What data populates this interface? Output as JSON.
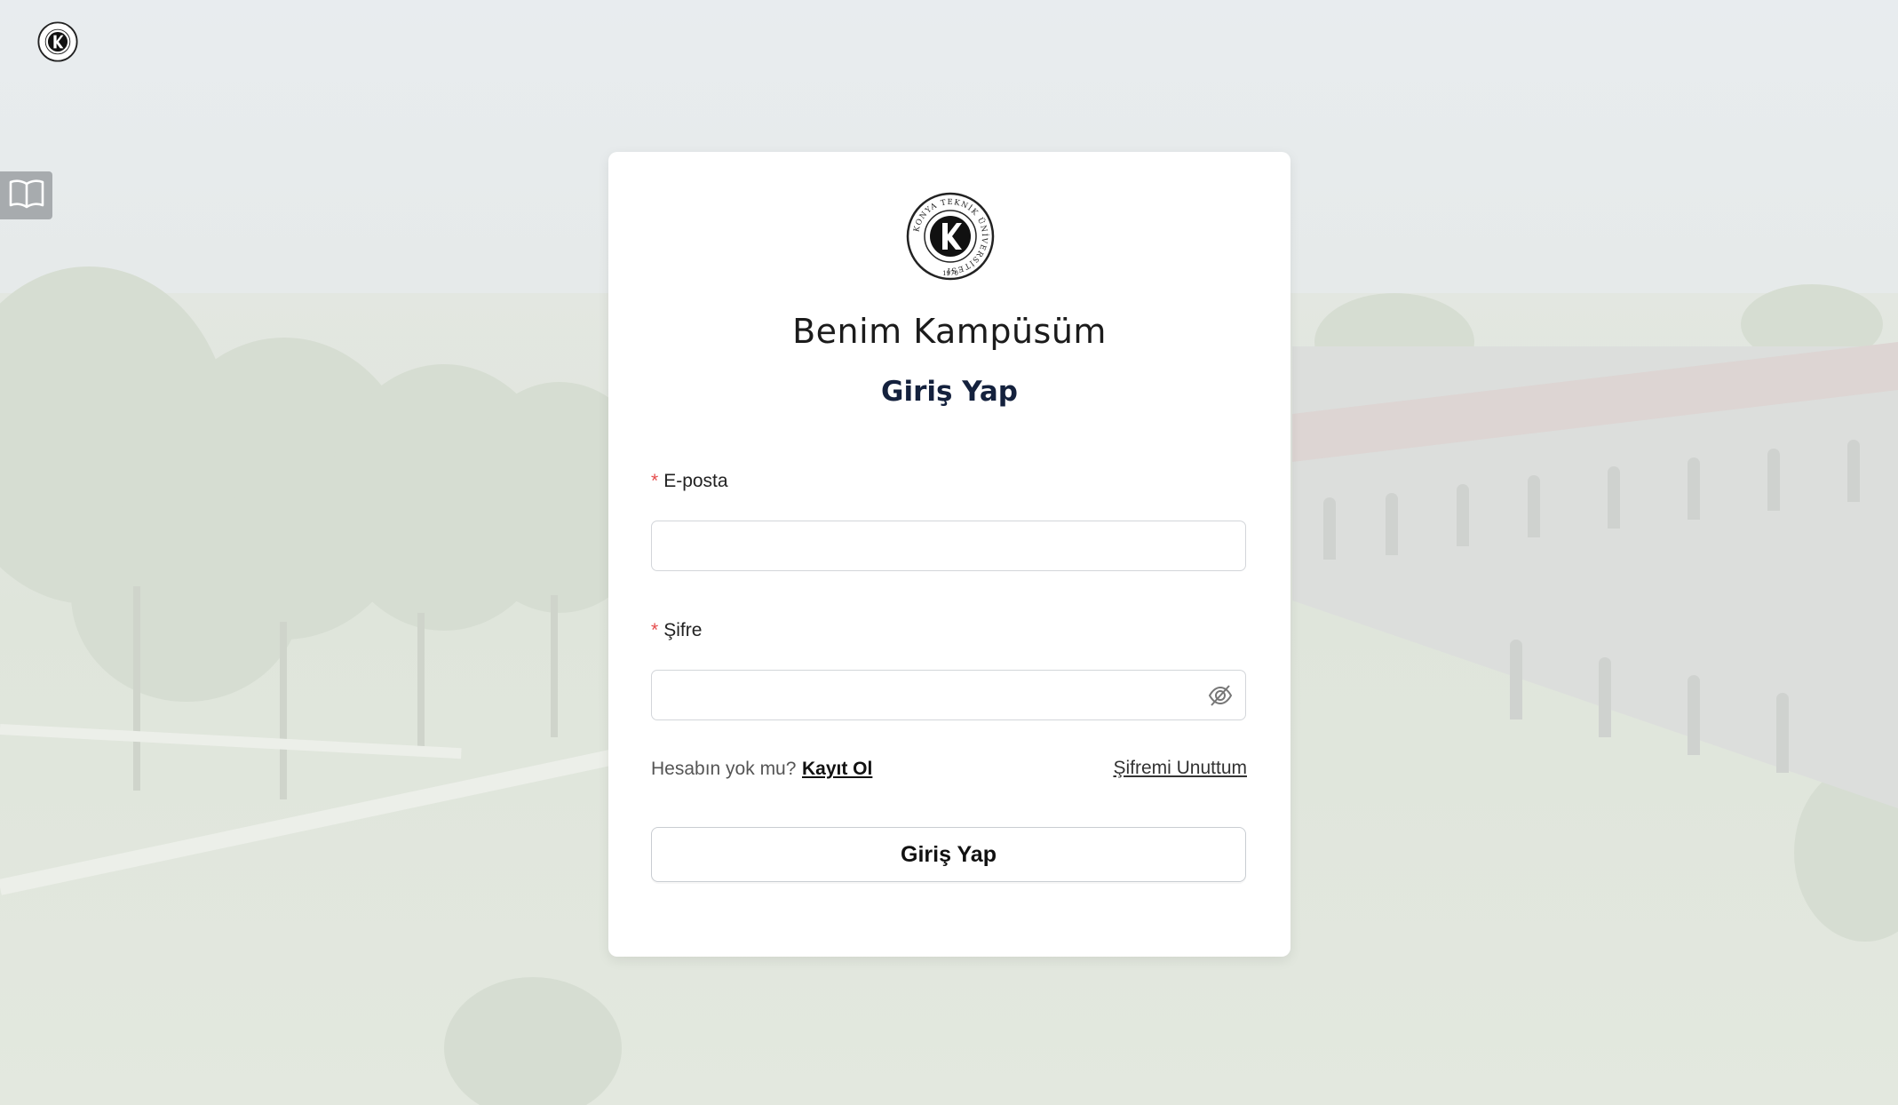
{
  "app": {
    "title": "Benim Kampüsüm",
    "logo_icon": "university-seal-icon",
    "logo_text": "KONYA TEKNİK ÜNİVERSİTESİ",
    "logo_year": "1970"
  },
  "side_tab": {
    "icon": "book-icon"
  },
  "login": {
    "title": "Giriş Yap",
    "email_label": "E-posta",
    "email_value": "",
    "email_placeholder": "",
    "password_label": "Şifre",
    "password_value": "",
    "password_placeholder": "",
    "password_toggle_icon": "eye-slash-icon",
    "required_mark": "*",
    "no_account_text": "Hesabın yok mu?",
    "register_link": "Kayıt Ol",
    "forgot_link": "Şifremi Unuttum",
    "submit_label": "Giriş Yap"
  },
  "colors": {
    "required": "#e54b4b",
    "title_dark": "#14213d",
    "side_tab": "#a7abae"
  }
}
